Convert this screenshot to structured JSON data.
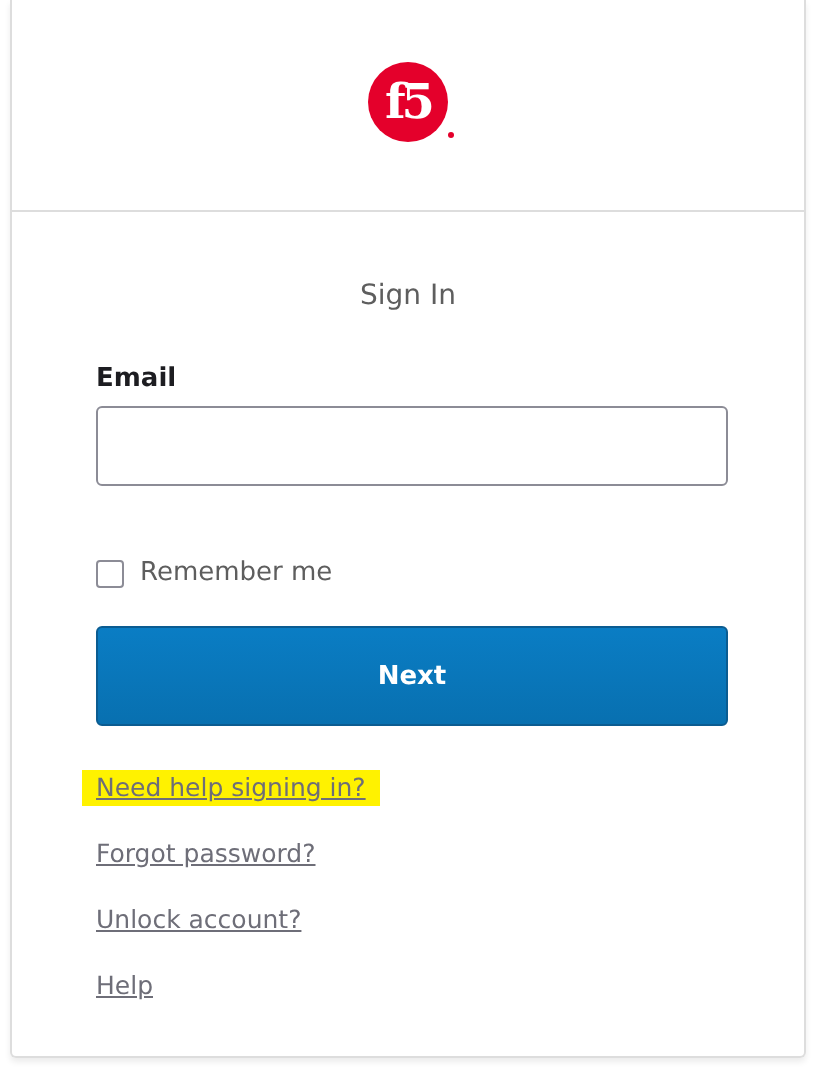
{
  "logo": {
    "text": "f5"
  },
  "title": "Sign In",
  "email": {
    "label": "Email"
  },
  "remember": {
    "label": "Remember me",
    "checked": false
  },
  "next_button": "Next",
  "links": [
    {
      "label": "Need help signing in?",
      "highlighted": true
    },
    {
      "label": "Forgot password?",
      "highlighted": false
    },
    {
      "label": "Unlock account?",
      "highlighted": false
    },
    {
      "label": "Help",
      "highlighted": false
    }
  ]
}
